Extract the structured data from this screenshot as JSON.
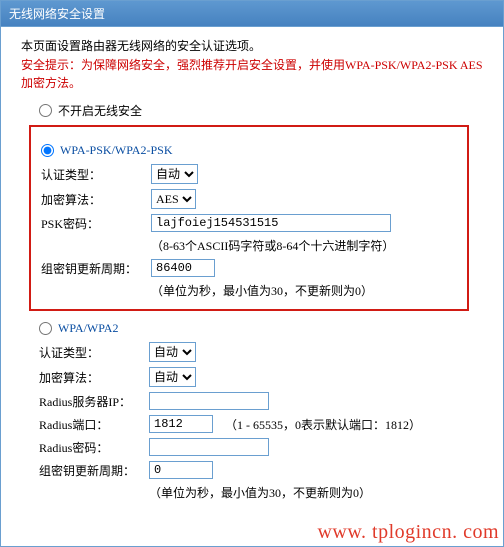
{
  "title": "无线网络安全设置",
  "intro": "本页面设置路由器无线网络的安全认证选项。",
  "warning": "安全提示：为保障网络安全，强烈推荐开启安全设置，并使用WPA-PSK/WPA2-PSK AES加密方法。",
  "options": {
    "none": {
      "label": "不开启无线安全",
      "checked": false
    },
    "wpapsk": {
      "label": "WPA-PSK/WPA2-PSK",
      "checked": true
    },
    "wpa": {
      "label": "WPA/WPA2",
      "checked": false
    }
  },
  "wpapsk": {
    "auth_label": "认证类型：",
    "auth_value": "自动",
    "cipher_label": "加密算法：",
    "cipher_value": "AES",
    "psk_label": "PSK密码：",
    "psk_value": "lajfoiej154531515",
    "psk_hint": "（8-63个ASCII码字符或8-64个十六进制字符）",
    "rekey_label": "组密钥更新周期：",
    "rekey_value": "86400",
    "rekey_hint": "（单位为秒，最小值为30，不更新则为0）"
  },
  "wpa": {
    "auth_label": "认证类型：",
    "auth_value": "自动",
    "cipher_label": "加密算法：",
    "cipher_value": "自动",
    "radius_ip_label": "Radius服务器IP：",
    "radius_ip_value": "",
    "radius_port_label": "Radius端口：",
    "radius_port_value": "1812",
    "radius_port_hint": "（1 - 65535，0表示默认端口：1812）",
    "radius_pw_label": "Radius密码：",
    "radius_pw_value": "",
    "rekey_label": "组密钥更新周期：",
    "rekey_value": "0",
    "rekey_hint": "（单位为秒，最小值为30，不更新则为0）"
  },
  "watermark": "www. tplogincn. com"
}
